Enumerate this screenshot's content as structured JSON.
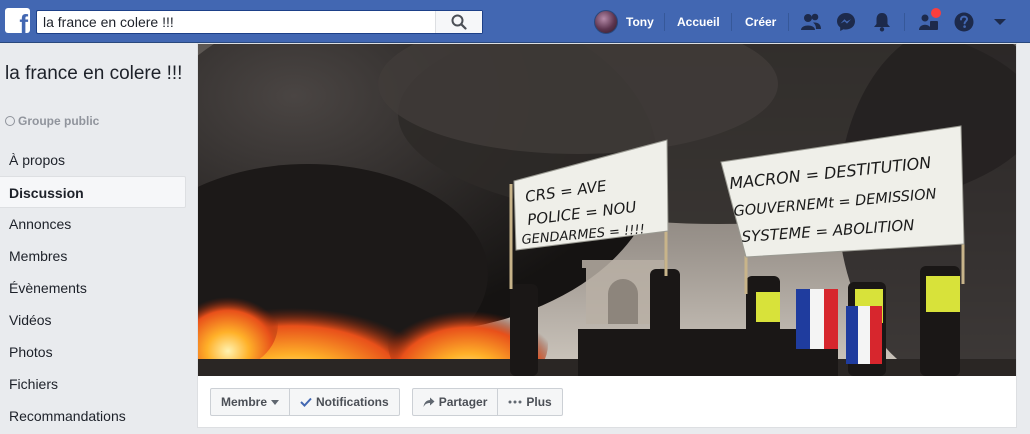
{
  "topbar": {
    "logo_letter": "f",
    "search_value": "la france en colere !!!",
    "user_name": "Tony",
    "home_label": "Accueil",
    "create_label": "Créer",
    "icons": [
      "friends-icon",
      "messenger-icon",
      "notifications-icon",
      "quick-help-icon",
      "help-icon",
      "dropdown-arrow-icon"
    ],
    "accent_color": "#4267b2"
  },
  "sidebar": {
    "group_name": "la france en colere !!!",
    "group_type": "Groupe public",
    "items": [
      {
        "label": "À propos"
      },
      {
        "label": "Discussion"
      },
      {
        "label": "Annonces"
      },
      {
        "label": "Membres"
      },
      {
        "label": "Évènements"
      },
      {
        "label": "Vidéos"
      },
      {
        "label": "Photos"
      },
      {
        "label": "Fichiers"
      },
      {
        "label": "Recommandations"
      }
    ],
    "active_item": "Discussion"
  },
  "cover": {
    "banner_left": [
      "CRS = AVE",
      "POLICE = NOU",
      "GENDARMES = !!!!"
    ],
    "banner_right": [
      "MACRON = DESTITUTION",
      "GOUVERNEMt = DEMISSION",
      "SYSTEME = ABOLITION"
    ]
  },
  "actions": {
    "member_label": "Membre",
    "notifications_label": "Notifications",
    "share_label": "Partager",
    "more_label": "Plus"
  }
}
